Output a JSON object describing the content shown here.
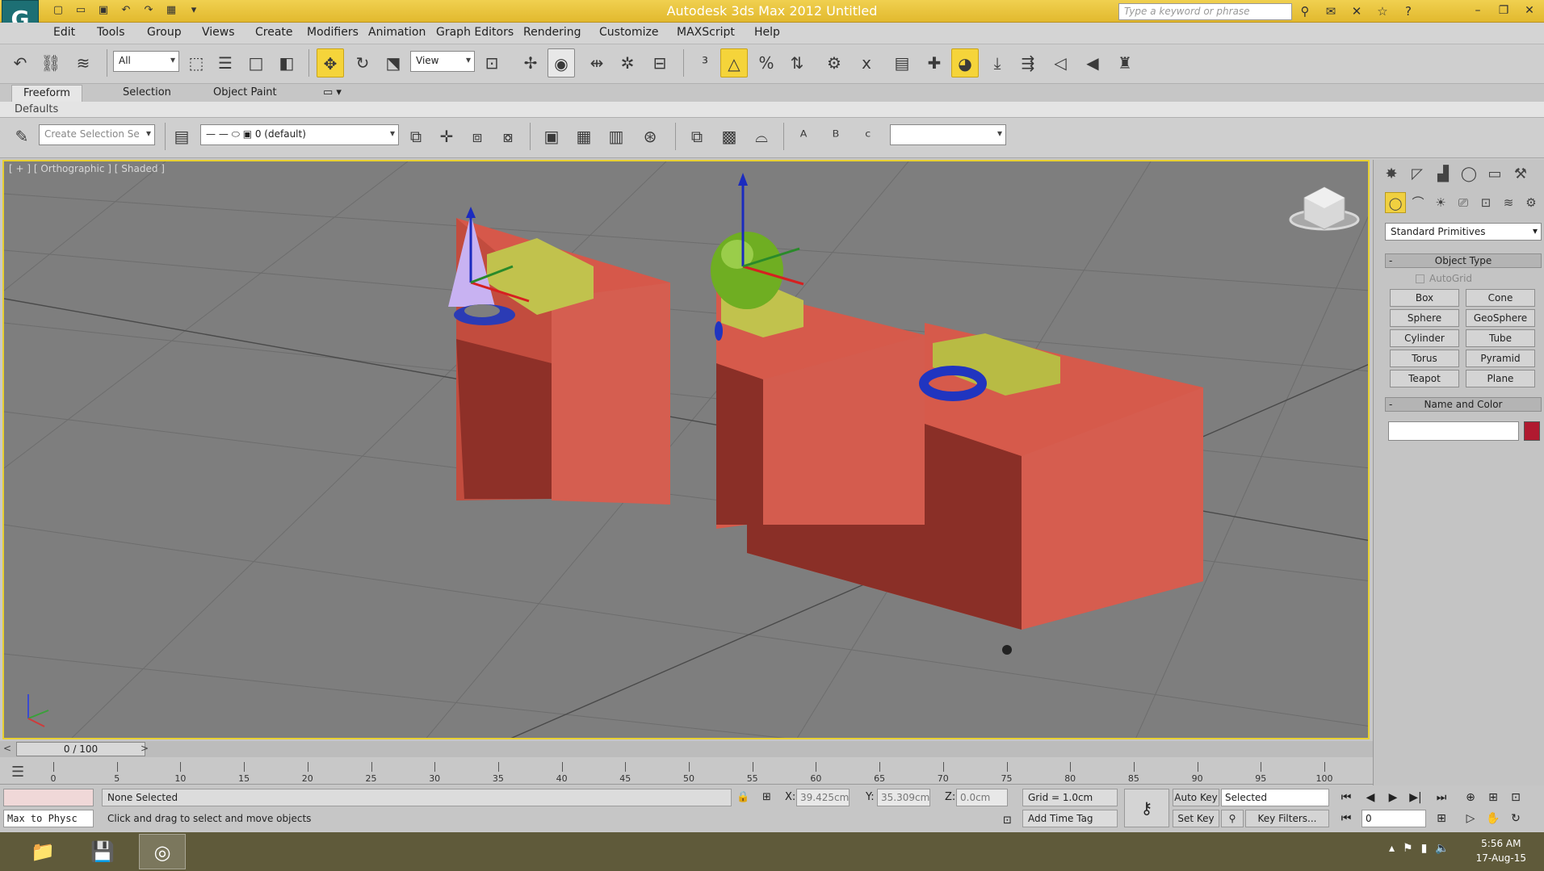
{
  "titlebar": {
    "title": "Autodesk 3ds Max  2012      Untitled",
    "search_placeholder": "Type a keyword or phrase",
    "qat_icons": [
      "new-icon",
      "open-icon",
      "save-icon",
      "undo-icon",
      "redo-icon",
      "project-icon"
    ]
  },
  "menu": [
    "Edit",
    "Tools",
    "Group",
    "Views",
    "Create",
    "Modifiers",
    "Animation",
    "Graph Editors",
    "Rendering",
    "Customize",
    "MAXScript",
    "Help"
  ],
  "toolbar": {
    "selection_filter": "All",
    "reference_coord": "View"
  },
  "ribbon": {
    "tabs": [
      "Freeform",
      "Selection",
      "Object Paint"
    ],
    "defaults_label": "Defaults"
  },
  "layer_toolbar": {
    "selection_set_placeholder": "Create Selection Se",
    "layer_name": "0 (default)"
  },
  "viewport": {
    "label": "[ + ] [ Orthographic ] [ Shaded ]"
  },
  "command_panel": {
    "category": "Standard Primitives",
    "object_type_title": "Object Type",
    "autogrid_label": "AutoGrid",
    "primitives": [
      "Box",
      "Cone",
      "Sphere",
      "GeoSphere",
      "Cylinder",
      "Tube",
      "Torus",
      "Pyramid",
      "Teapot",
      "Plane"
    ],
    "name_color_title": "Name and Color",
    "object_color": "#b01a30"
  },
  "timeline": {
    "frame_display": "0 / 100",
    "ticks": [
      0,
      5,
      10,
      15,
      20,
      25,
      30,
      35,
      40,
      45,
      50,
      55,
      60,
      65,
      70,
      75,
      80,
      85,
      90,
      95,
      100
    ]
  },
  "status": {
    "maxscript_listener": "Max to Physc",
    "selection_status": "None Selected",
    "prompt": "Click and drag to select and move objects",
    "x_label": "X:",
    "x_value": "39.425cm",
    "y_label": "Y:",
    "y_value": "35.309cm",
    "z_label": "Z:",
    "z_value": "0.0cm",
    "grid": "Grid = 1.0cm",
    "add_time_tag": "Add Time Tag",
    "auto_key": "Auto Key",
    "set_key": "Set Key",
    "key_mode": "Selected",
    "key_filters": "Key Filters...",
    "current_frame": "0"
  },
  "taskbar": {
    "time": "5:56 AM",
    "date": "17-Aug-15"
  }
}
